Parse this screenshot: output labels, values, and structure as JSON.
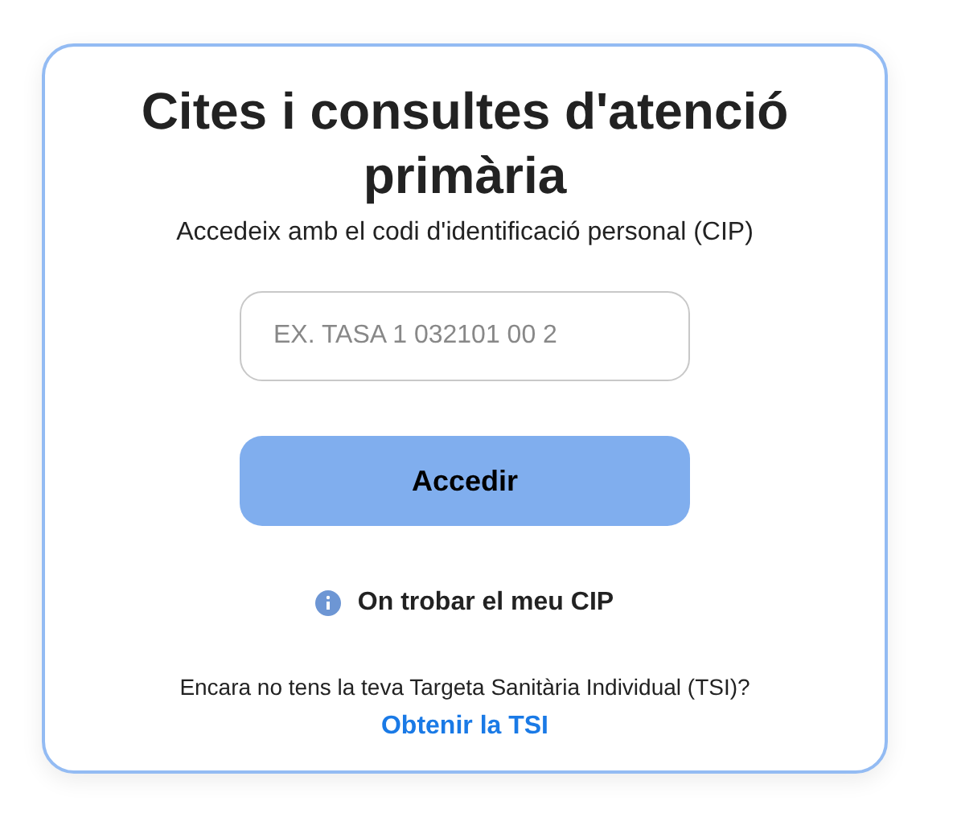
{
  "title": "Cites i consultes d'atenció primària",
  "subtitle": "Accedeix amb el codi d'identificació personal (CIP)",
  "cip_field": {
    "placeholder": "EX. TASA 1 032101 00 2"
  },
  "submit_button": "Accedir",
  "help_link": "On trobar el meu CIP",
  "tsi_prompt": "Encara no tens la teva Targeta Sanitària Individual (TSI)?",
  "tsi_link": "Obtenir la TSI"
}
